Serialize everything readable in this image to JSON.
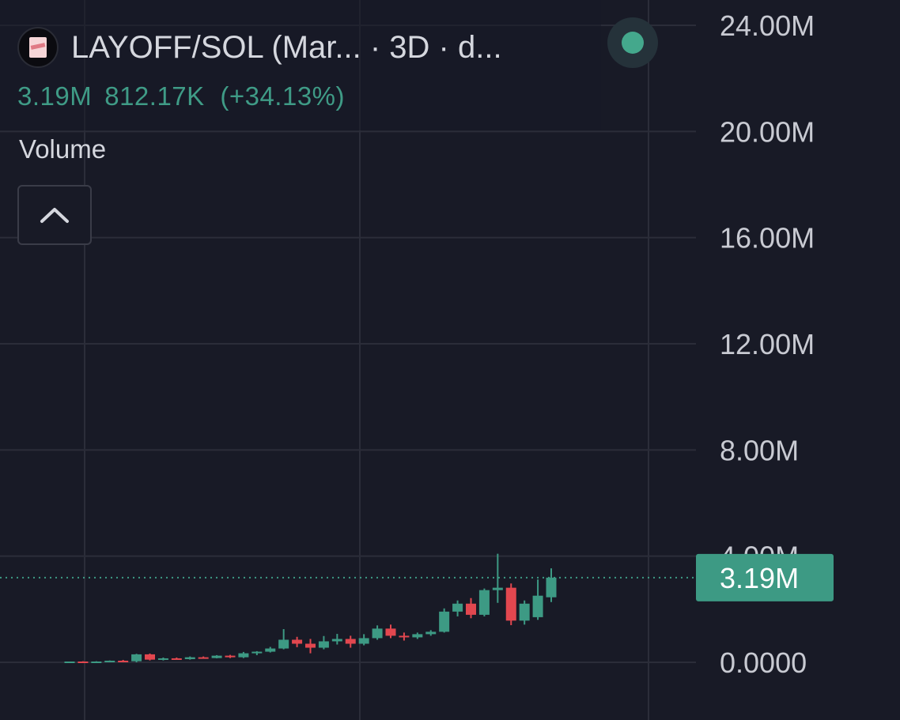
{
  "header": {
    "symbol_title": "LAYOFF/SOL (Mar... · 3D · d...",
    "last_value": "3.19M",
    "change_value": "812.17K",
    "change_pct": "(+34.13%)",
    "indicator_label": "Volume",
    "icons": {
      "token": "token-avatar-icon",
      "status": "status-dot-icon",
      "collapse": "chevron-up-icon"
    }
  },
  "colors": {
    "background": "#181a26",
    "up": "#3d9a84",
    "down": "#e2474f",
    "grid": "#2b2d39",
    "text": "#c8cad2",
    "status_dot": "#44a88c"
  },
  "price_tag": {
    "label": "3.19M",
    "value": 3190000
  },
  "chart_data": {
    "type": "candlestick",
    "title": "LAYOFF/SOL (Mar... · 3D · d...",
    "ylim": [
      0,
      24000000
    ],
    "y_ticks": [
      0,
      4000000,
      8000000,
      12000000,
      16000000,
      20000000,
      24000000
    ],
    "y_tick_labels": [
      "0.0000",
      "4.00M",
      "8.00M",
      "12.00M",
      "16.00M",
      "20.00M",
      "24.00M"
    ],
    "grid": true,
    "last_price": 3190000,
    "candles": [
      {
        "o": 0.0,
        "h": 0.03,
        "l": 0.0,
        "c": 0.03
      },
      {
        "o": 0.03,
        "h": 0.04,
        "l": 0.0,
        "c": 0.0
      },
      {
        "o": 0.0,
        "h": 0.04,
        "l": 0.0,
        "c": 0.03
      },
      {
        "o": 0.03,
        "h": 0.07,
        "l": 0.0,
        "c": 0.06
      },
      {
        "o": 0.06,
        "h": 0.09,
        "l": 0.0,
        "c": 0.04
      },
      {
        "o": 0.04,
        "h": 0.32,
        "l": 0.0,
        "c": 0.3
      },
      {
        "o": 0.3,
        "h": 0.33,
        "l": 0.07,
        "c": 0.1
      },
      {
        "o": 0.1,
        "h": 0.18,
        "l": 0.07,
        "c": 0.15
      },
      {
        "o": 0.15,
        "h": 0.18,
        "l": 0.1,
        "c": 0.12
      },
      {
        "o": 0.12,
        "h": 0.22,
        "l": 0.1,
        "c": 0.19
      },
      {
        "o": 0.19,
        "h": 0.22,
        "l": 0.15,
        "c": 0.16
      },
      {
        "o": 0.16,
        "h": 0.27,
        "l": 0.15,
        "c": 0.25
      },
      {
        "o": 0.25,
        "h": 0.28,
        "l": 0.16,
        "c": 0.19
      },
      {
        "o": 0.19,
        "h": 0.39,
        "l": 0.16,
        "c": 0.34
      },
      {
        "o": 0.34,
        "h": 0.42,
        "l": 0.27,
        "c": 0.4
      },
      {
        "o": 0.4,
        "h": 0.58,
        "l": 0.37,
        "c": 0.52
      },
      {
        "o": 0.52,
        "h": 1.25,
        "l": 0.49,
        "c": 0.85
      },
      {
        "o": 0.85,
        "h": 0.96,
        "l": 0.57,
        "c": 0.7
      },
      {
        "o": 0.7,
        "h": 0.88,
        "l": 0.34,
        "c": 0.55
      },
      {
        "o": 0.55,
        "h": 0.99,
        "l": 0.49,
        "c": 0.79
      },
      {
        "o": 0.79,
        "h": 1.07,
        "l": 0.67,
        "c": 0.88
      },
      {
        "o": 0.88,
        "h": 1.0,
        "l": 0.55,
        "c": 0.7
      },
      {
        "o": 0.7,
        "h": 1.06,
        "l": 0.64,
        "c": 0.91
      },
      {
        "o": 0.91,
        "h": 1.39,
        "l": 0.85,
        "c": 1.27
      },
      {
        "o": 1.27,
        "h": 1.42,
        "l": 0.91,
        "c": 1.0
      },
      {
        "o": 1.0,
        "h": 1.12,
        "l": 0.82,
        "c": 0.94
      },
      {
        "o": 0.94,
        "h": 1.12,
        "l": 0.88,
        "c": 1.06
      },
      {
        "o": 1.06,
        "h": 1.21,
        "l": 1.0,
        "c": 1.15
      },
      {
        "o": 1.15,
        "h": 2.03,
        "l": 1.12,
        "c": 1.91
      },
      {
        "o": 1.91,
        "h": 2.33,
        "l": 1.73,
        "c": 2.21
      },
      {
        "o": 2.21,
        "h": 2.42,
        "l": 1.66,
        "c": 1.79
      },
      {
        "o": 1.79,
        "h": 2.78,
        "l": 1.73,
        "c": 2.72
      },
      {
        "o": 2.72,
        "h": 4.09,
        "l": 2.24,
        "c": 2.81
      },
      {
        "o": 2.81,
        "h": 2.97,
        "l": 1.4,
        "c": 1.57
      },
      {
        "o": 1.57,
        "h": 2.33,
        "l": 1.42,
        "c": 2.21
      },
      {
        "o": 1.7,
        "h": 3.12,
        "l": 1.6,
        "c": 2.51
      },
      {
        "o": 2.45,
        "h": 3.54,
        "l": 2.27,
        "c": 3.19
      }
    ]
  }
}
